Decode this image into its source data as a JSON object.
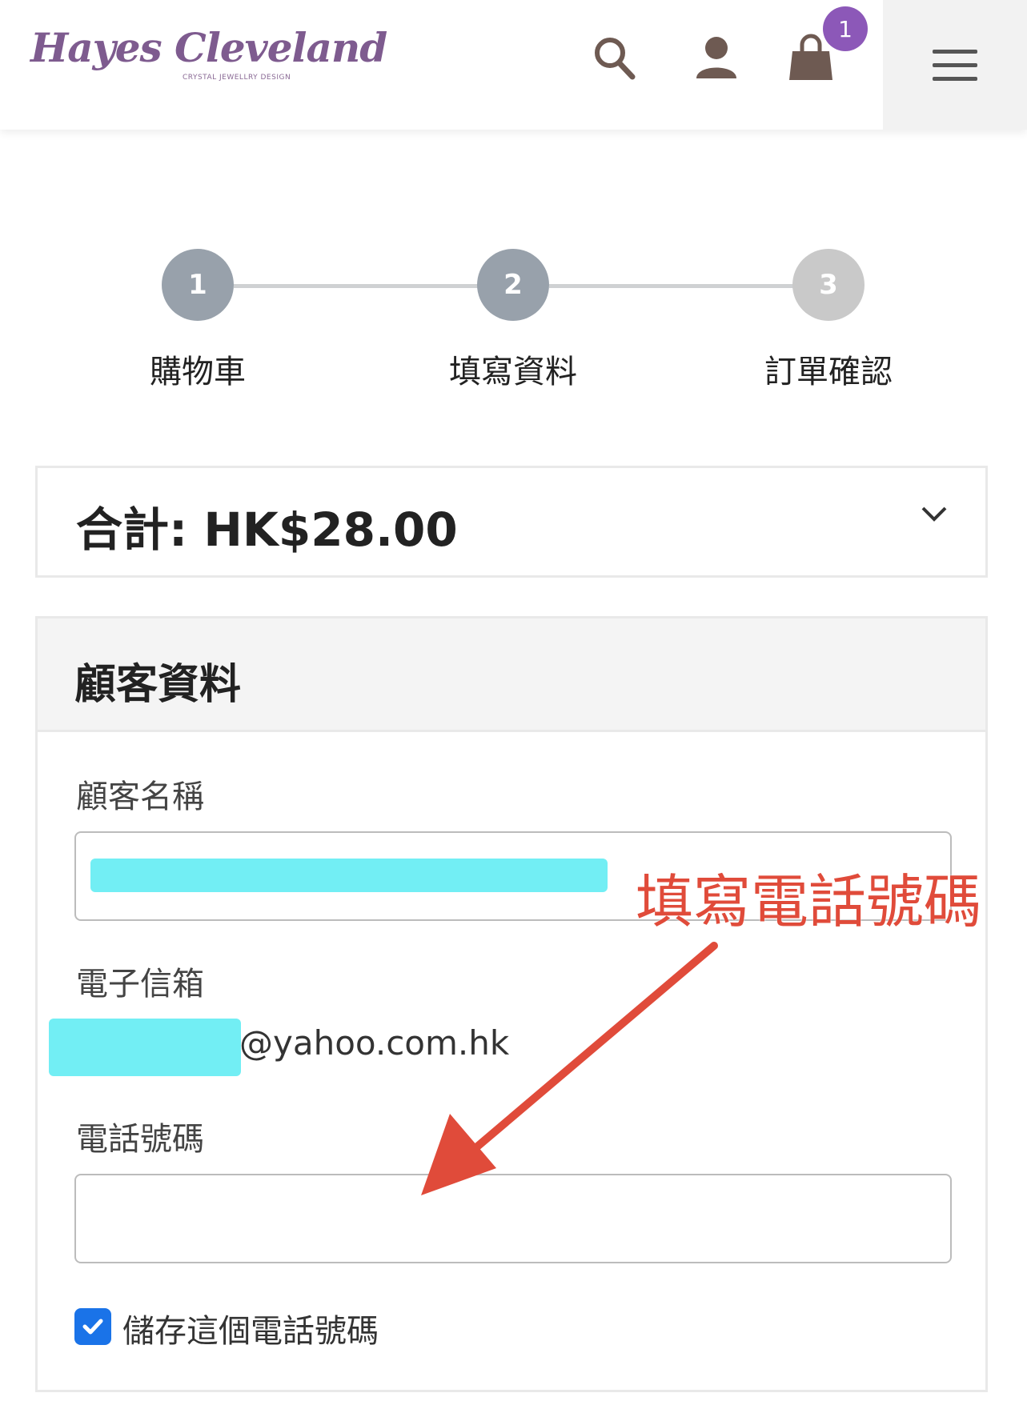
{
  "header": {
    "logo_text": "Hayes Cleveland",
    "logo_subtitle": "CRYSTAL JEWELLRY DESIGN",
    "icons": [
      "search-icon",
      "user-icon",
      "shopping-bag-icon",
      "hamburger-menu-icon"
    ],
    "cart_count": "1",
    "accent_color": "#8c58b8"
  },
  "stepper": {
    "steps": [
      {
        "number": "1",
        "label": "購物車",
        "state": "done"
      },
      {
        "number": "2",
        "label": "填寫資料",
        "state": "current"
      },
      {
        "number": "3",
        "label": "訂單確認",
        "state": "pending"
      }
    ]
  },
  "total": {
    "text": "合計: HK$28.00"
  },
  "customer": {
    "title": "顧客資料",
    "name_label": "顧客名稱",
    "name_value": "",
    "email_label": "電子信箱",
    "email_value": "@yahoo.com.hk",
    "phone_label": "電話號碼",
    "phone_value": "",
    "save_phone_label": "儲存這個電話號碼",
    "save_phone_checked": true
  },
  "annotation": {
    "text": "填寫電話號碼",
    "color": "#e04b3a"
  }
}
